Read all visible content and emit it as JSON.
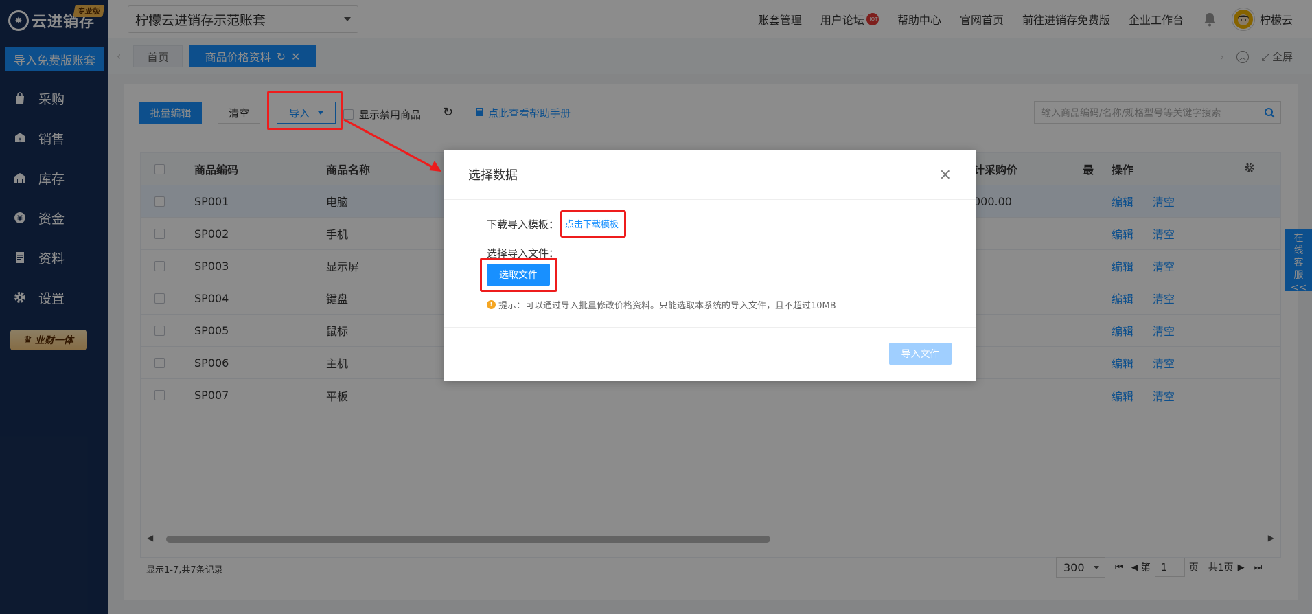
{
  "brand": {
    "logo_mark": "✸",
    "name": "云进销存",
    "badge": "专业版"
  },
  "sidebar": {
    "import_free": "导入免费版账套",
    "items": [
      {
        "label": "采购",
        "icon": "bag-icon"
      },
      {
        "label": "销售",
        "icon": "sales-icon"
      },
      {
        "label": "库存",
        "icon": "warehouse-icon"
      },
      {
        "label": "资金",
        "icon": "yen-icon"
      },
      {
        "label": "资料",
        "icon": "document-icon"
      },
      {
        "label": "设置",
        "icon": "gear-icon"
      }
    ],
    "promo": "业财一体"
  },
  "topbar": {
    "account": "柠檬云进销存示范账套",
    "links": [
      "账套管理",
      "用户论坛",
      "帮助中心",
      "官网首页",
      "前往进销存免费版",
      "企业工作台"
    ],
    "hot_badge": "HOT",
    "username": "柠檬云"
  },
  "tabs": {
    "home": "首页",
    "active": "商品价格资料",
    "fullscreen": "全屏"
  },
  "toolbar": {
    "batch_edit": "批量编辑",
    "clear": "清空",
    "import": "导入",
    "show_disabled": "显示禁用商品",
    "help": "点此查看帮助手册",
    "search_placeholder": "输入商品编码/名称/规格型号等关键字搜索"
  },
  "table": {
    "headers": {
      "code": "商品编码",
      "name": "商品名称",
      "price": "计采购价",
      "extra": "最",
      "action": "操作"
    },
    "rows": [
      {
        "code": "SP001",
        "name": "电脑",
        "price": "000.00"
      },
      {
        "code": "SP002",
        "name": "手机",
        "price": ""
      },
      {
        "code": "SP003",
        "name": "显示屏",
        "price": ""
      },
      {
        "code": "SP004",
        "name": "键盘",
        "price": ""
      },
      {
        "code": "SP005",
        "name": "鼠标",
        "price": ""
      },
      {
        "code": "SP006",
        "name": "主机",
        "price": ""
      },
      {
        "code": "SP007",
        "name": "平板",
        "price": ""
      }
    ],
    "edit": "编辑",
    "clear": "清空"
  },
  "footer": {
    "count": "显示1-7,共7条记录",
    "page_size": "300",
    "page_prefix": "第",
    "page_value": "1",
    "page_suffix": "页",
    "total_pages": "共1页"
  },
  "float_service": {
    "label": "在线客服",
    "arrow": "<<"
  },
  "modal": {
    "title": "选择数据",
    "download_label": "下载导入模板：",
    "download_link": "点击下载模板",
    "file_label": "选择导入文件：",
    "choose_button": "选取文件",
    "hint": "提示：可以通过导入批量修改价格资料。只能选取本系统的导入文件，且不超过10MB",
    "import_button": "导入文件"
  },
  "colors": {
    "sidebar": "#172f58",
    "primary": "#1890ff",
    "annotation": "#ee1c1c"
  }
}
